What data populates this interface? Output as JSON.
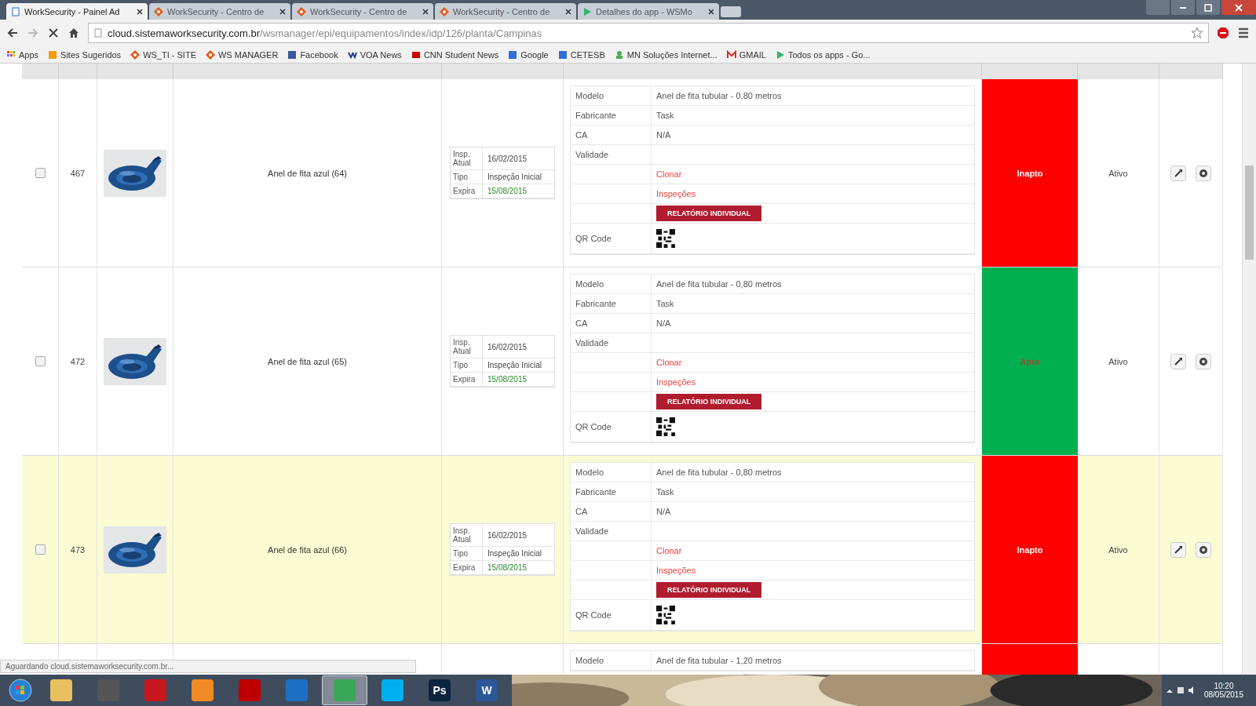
{
  "browser": {
    "tabs": [
      {
        "title": "WorkSecurity - Painel Ad",
        "selected": true
      },
      {
        "title": "WorkSecurity - Centro de",
        "selected": false
      },
      {
        "title": "WorkSecurity - Centro de",
        "selected": false
      },
      {
        "title": "WorkSecurity - Centro de",
        "selected": false
      },
      {
        "title": "Detalhes do app - WSMo",
        "selected": false
      }
    ],
    "address": {
      "host": "cloud.sistemaworksecurity.com.br",
      "path": "/wsmanager/epi/equipamentos/index/idp/126/planta/Campinas"
    },
    "bookmarks": [
      {
        "label": "Apps"
      },
      {
        "label": "Sites Sugeridos"
      },
      {
        "label": "WS_TI - SITE"
      },
      {
        "label": "WS MANAGER"
      },
      {
        "label": "Facebook"
      },
      {
        "label": "VOA News"
      },
      {
        "label": "CNN Student News"
      },
      {
        "label": "Google"
      },
      {
        "label": "CETESB"
      },
      {
        "label": "MN Soluções Internet..."
      },
      {
        "label": "GMAIL"
      },
      {
        "label": "Todos os apps - Go..."
      }
    ]
  },
  "table": {
    "rows": [
      {
        "checked": false,
        "highlighted": false,
        "id": "467",
        "name": "Anel de fita azul (64)",
        "inspection": [
          {
            "label": "Insp. Atual",
            "value": "16/02/2015",
            "kind": "plain"
          },
          {
            "label": "Tipo",
            "value": "Inspeção Inicial",
            "kind": "plain"
          },
          {
            "label": "Expira",
            "value": "15/08/2015",
            "kind": "date-ok"
          }
        ],
        "specs": [
          {
            "kind": "field",
            "label": "Modelo",
            "value": "Anel de fita tubular - 0,80 metros"
          },
          {
            "kind": "field",
            "label": "Fabricante",
            "value": "Task"
          },
          {
            "kind": "field",
            "label": "CA",
            "value": "N/A"
          },
          {
            "kind": "field",
            "label": "Validade"
          },
          {
            "kind": "link",
            "value": "Clonar"
          },
          {
            "kind": "link",
            "value": "Inspeções"
          },
          {
            "kind": "button",
            "value": "RELATÓRIO INDIVIDUAL"
          },
          {
            "kind": "qr",
            "label": "QR Code"
          }
        ],
        "result": {
          "label": "Inapto",
          "passed": false
        },
        "status": "Ativo"
      },
      {
        "checked": false,
        "highlighted": false,
        "id": "472",
        "name": "Anel de fita azul (65)",
        "inspection": [
          {
            "label": "Insp. Atual",
            "value": "16/02/2015",
            "kind": "plain"
          },
          {
            "label": "Tipo",
            "value": "Inspeção Inicial",
            "kind": "plain"
          },
          {
            "label": "Expira",
            "value": "15/08/2015",
            "kind": "date-ok"
          }
        ],
        "specs": [
          {
            "kind": "field",
            "label": "Modelo",
            "value": "Anel de fita tubular - 0,80 metros"
          },
          {
            "kind": "field",
            "label": "Fabricante",
            "value": "Task"
          },
          {
            "kind": "field",
            "label": "CA",
            "value": "N/A"
          },
          {
            "kind": "field",
            "label": "Validade"
          },
          {
            "kind": "link",
            "value": "Clonar"
          },
          {
            "kind": "link",
            "value": "Inspeções"
          },
          {
            "kind": "button",
            "value": "RELATÓRIO INDIVIDUAL"
          },
          {
            "kind": "qr",
            "label": "QR Code"
          }
        ],
        "result": {
          "label": "Apto",
          "passed": true
        },
        "status": "Ativo"
      },
      {
        "checked": false,
        "highlighted": true,
        "id": "473",
        "name": "Anel de fita azul (66)",
        "inspection": [
          {
            "label": "Insp. Atual",
            "value": "16/02/2015",
            "kind": "plain"
          },
          {
            "label": "Tipo",
            "value": "Inspeção Inicial",
            "kind": "plain"
          },
          {
            "label": "Expira",
            "value": "15/08/2015",
            "kind": "date-ok"
          }
        ],
        "specs": [
          {
            "kind": "field",
            "label": "Modelo",
            "value": "Anel de fita tubular - 0,80 metros"
          },
          {
            "kind": "field",
            "label": "Fabricante",
            "value": "Task"
          },
          {
            "kind": "field",
            "label": "CA",
            "value": "N/A"
          },
          {
            "kind": "field",
            "label": "Validade"
          },
          {
            "kind": "link",
            "value": "Clonar"
          },
          {
            "kind": "link",
            "value": "Inspeções"
          },
          {
            "kind": "button",
            "value": "RELATÓRIO INDIVIDUAL"
          },
          {
            "kind": "qr",
            "label": "QR Code"
          }
        ],
        "result": {
          "label": "Inapto",
          "passed": false
        },
        "status": "Ativo"
      },
      {
        "highlighted": false,
        "specs": [
          {
            "kind": "field",
            "label": "Modelo",
            "value": "Anel de fita tubular - 1,20 metros"
          }
        ],
        "result": {
          "passed": false
        }
      }
    ]
  },
  "status_bar": "Aguardando cloud.sistemaworksecurity.com.br...",
  "taskbar": {
    "apps": [
      {
        "kind": "folder",
        "selected": false
      },
      {
        "kind": "tool",
        "selected": false
      },
      {
        "kind": "acrobat",
        "selected": false
      },
      {
        "kind": "media",
        "selected": false
      },
      {
        "kind": "filezilla",
        "selected": false
      },
      {
        "kind": "teamviewer",
        "selected": false
      },
      {
        "kind": "chrome",
        "selected": true
      },
      {
        "kind": "skype",
        "selected": false
      },
      {
        "kind": "photoshop",
        "glyph": "Ps",
        "selected": false
      },
      {
        "kind": "word",
        "glyph": "W",
        "selected": false
      }
    ],
    "time": "10:20",
    "date": "08/05/2015"
  }
}
